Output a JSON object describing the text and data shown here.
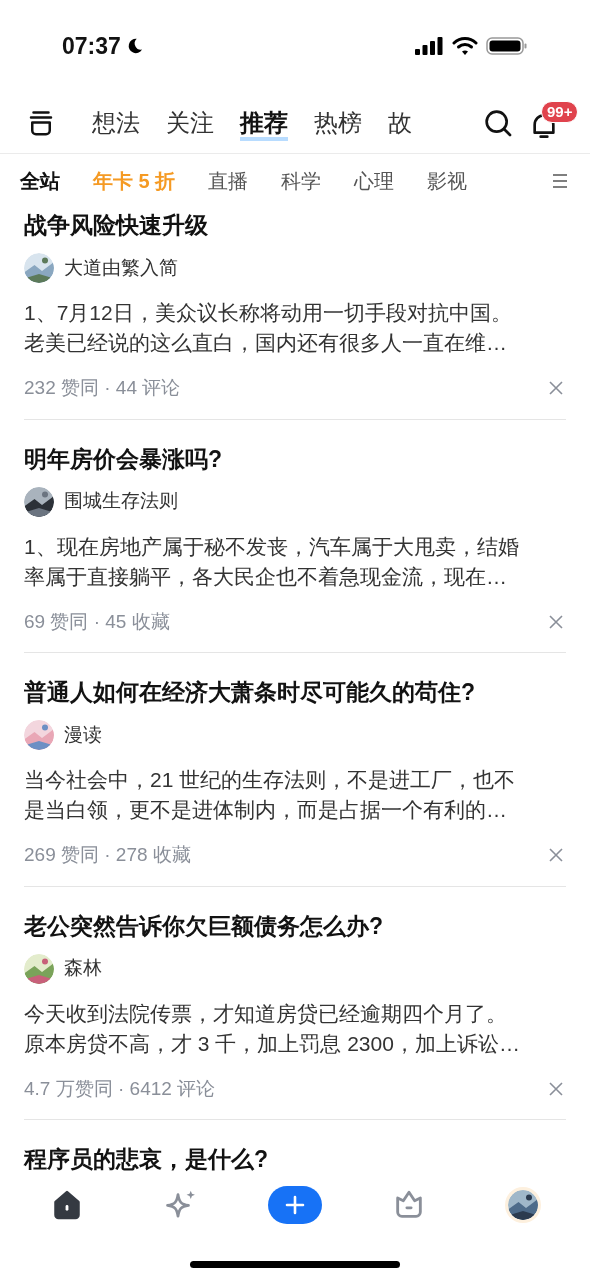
{
  "status_bar": {
    "time": "07:37"
  },
  "top_tabs": [
    {
      "label": "想法",
      "selected": false
    },
    {
      "label": "关注",
      "selected": false
    },
    {
      "label": "推荐",
      "selected": true
    },
    {
      "label": "热榜",
      "selected": false
    },
    {
      "label": "故",
      "selected": false
    }
  ],
  "notification_badge": "99+",
  "channels": [
    {
      "label": "全站",
      "selected": true,
      "kind": "normal"
    },
    {
      "label": "年卡 5 折",
      "selected": false,
      "kind": "promo"
    },
    {
      "label": "直播",
      "selected": false,
      "kind": "normal"
    },
    {
      "label": "科学",
      "selected": false,
      "kind": "normal"
    },
    {
      "label": "心理",
      "selected": false,
      "kind": "normal"
    },
    {
      "label": "影视",
      "selected": false,
      "kind": "normal"
    }
  ],
  "feed": [
    {
      "title": "战争风险快速升级",
      "author": "大道由繁入简",
      "excerpt_lines": [
        "1、7月12日，美众议长称将动用一切手段对抗中国。",
        "老美已经说的这么直白，国内还有很多人一直在维…"
      ],
      "meta": "232 赞同 · 44 评论"
    },
    {
      "title": "明年房价会暴涨吗?",
      "author": "围城生存法则",
      "excerpt_lines": [
        "1、现在房地产属于秘不发丧，汽车属于大甩卖，结婚",
        "率属于直接躺平，各大民企也不着急现金流，现在…"
      ],
      "meta": "69 赞同 · 45 收藏"
    },
    {
      "title": "普通人如何在经济大萧条时尽可能久的苟住?",
      "author": "漫读",
      "excerpt_lines": [
        "当今社会中，21 世纪的生存法则，不是进工厂，也不",
        "是当白领，更不是进体制内，而是占据一个有利的…"
      ],
      "meta": "269 赞同 · 278 收藏"
    },
    {
      "title": "老公突然告诉你欠巨额债务怎么办?",
      "author": "森林",
      "excerpt_lines": [
        "今天收到法院传票，才知道房贷已经逾期四个月了。",
        "原本房贷不高，才 3 千，加上罚息 2300，加上诉讼…"
      ],
      "meta": "4.7 万赞同 · 6412 评论"
    },
    {
      "title": "程序员的悲哀，是什么?"
    }
  ],
  "bottom_nav": [
    {
      "kind": "home",
      "selected": true
    },
    {
      "kind": "sparkle",
      "selected": false
    },
    {
      "kind": "plus",
      "selected": false
    },
    {
      "kind": "basket",
      "selected": false
    },
    {
      "kind": "avatar",
      "selected": false
    }
  ]
}
